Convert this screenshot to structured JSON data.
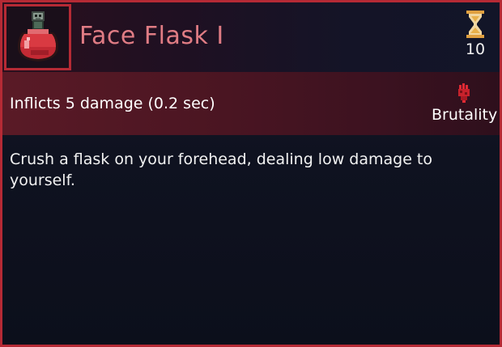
{
  "item": {
    "title": "Face Flask I",
    "icon": "red-potion-flask-icon",
    "cooldown": {
      "icon": "hourglass-icon",
      "value": "10"
    },
    "stat_line": "Inflicts 5 damage (0.2 sec)",
    "tag": {
      "icon": "brutality-fist-icon",
      "label": "Brutality"
    },
    "description": "Crush a flask on your forehead, dealing low damage to yourself."
  },
  "colors": {
    "border": "#b52a35",
    "title": "#e07c84",
    "stat_band": "#4a1522",
    "background": "#0f1220"
  }
}
